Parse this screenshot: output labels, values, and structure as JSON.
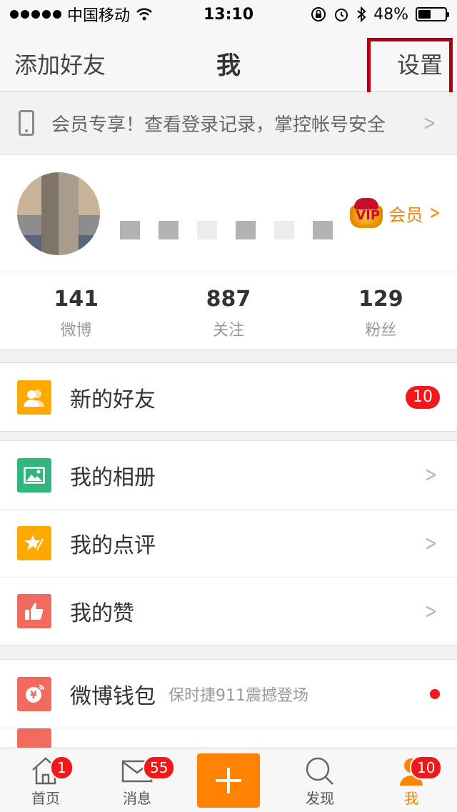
{
  "status_bar": {
    "carrier": "中国移动",
    "time": "13:10",
    "battery_percent": "48%",
    "battery_level": 0.48
  },
  "nav": {
    "left": "添加好友",
    "title": "我",
    "right": "设置"
  },
  "banner": {
    "text": "会员专享！查看登录记录，掌控帐号安全"
  },
  "profile": {
    "vip_label": "会员",
    "stats": [
      {
        "num": "141",
        "label": "微博"
      },
      {
        "num": "887",
        "label": "关注"
      },
      {
        "num": "129",
        "label": "粉丝"
      }
    ]
  },
  "menu": {
    "new_friends": {
      "label": "新的好友",
      "badge": "10"
    },
    "album": {
      "label": "我的相册"
    },
    "reviews": {
      "label": "我的点评"
    },
    "likes": {
      "label": "我的赞"
    },
    "wallet": {
      "label": "微博钱包",
      "sub": "保时捷911震撼登场"
    }
  },
  "tabbar": {
    "tabs": [
      {
        "label": "首页",
        "badge": "1"
      },
      {
        "label": "消息",
        "badge": "55"
      },
      {
        "label": ""
      },
      {
        "label": "发现"
      },
      {
        "label": "我",
        "badge": "10"
      }
    ]
  },
  "colors": {
    "accent": "#ff8200",
    "badge": "#f01818",
    "highlight": "#b00010",
    "icon_friends": "#ffa800",
    "icon_album": "#2fb57d",
    "icon_reviews": "#ffa800",
    "icon_likes": "#f26a5d",
    "icon_wallet": "#f26a5d"
  }
}
